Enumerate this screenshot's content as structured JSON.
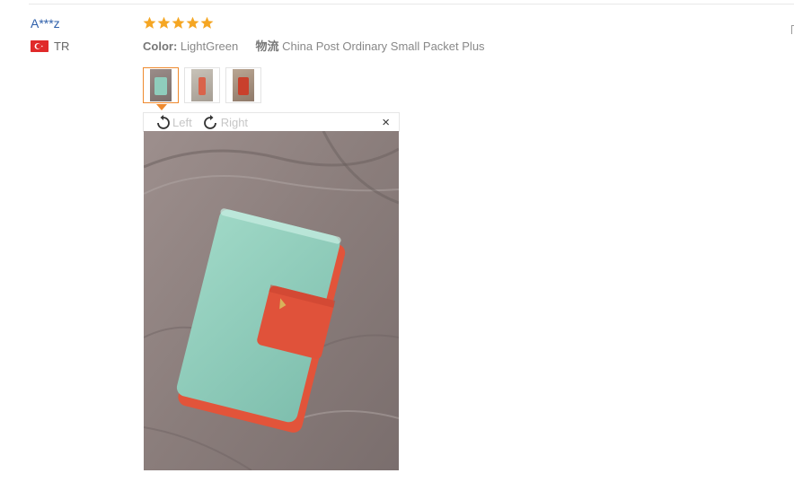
{
  "review": {
    "user_name": "A***z",
    "country_code": "TR",
    "rating": 5,
    "rating_max": 5,
    "specs": [
      {
        "key": "Color:",
        "value": "LightGreen"
      },
      {
        "key": "物流",
        "value": "China Post Ordinary Small Packet Plus"
      }
    ],
    "thumbnails": [
      "photo-1",
      "photo-2",
      "photo-3"
    ],
    "active_thumbnail": 0
  },
  "viewer": {
    "rotate_left_label": "Left",
    "rotate_right_label": "Right",
    "close_glyph": "×"
  },
  "icons": {
    "star": "star-icon",
    "rotate_left": "rotate-left-icon",
    "rotate_right": "rotate-right-icon",
    "close": "close-icon",
    "flag": "turkey-flag-icon"
  },
  "colors": {
    "star": "#f5a623",
    "link": "#2e5faa",
    "active_border": "#ef8a2e",
    "flag": "#e02a2a"
  }
}
